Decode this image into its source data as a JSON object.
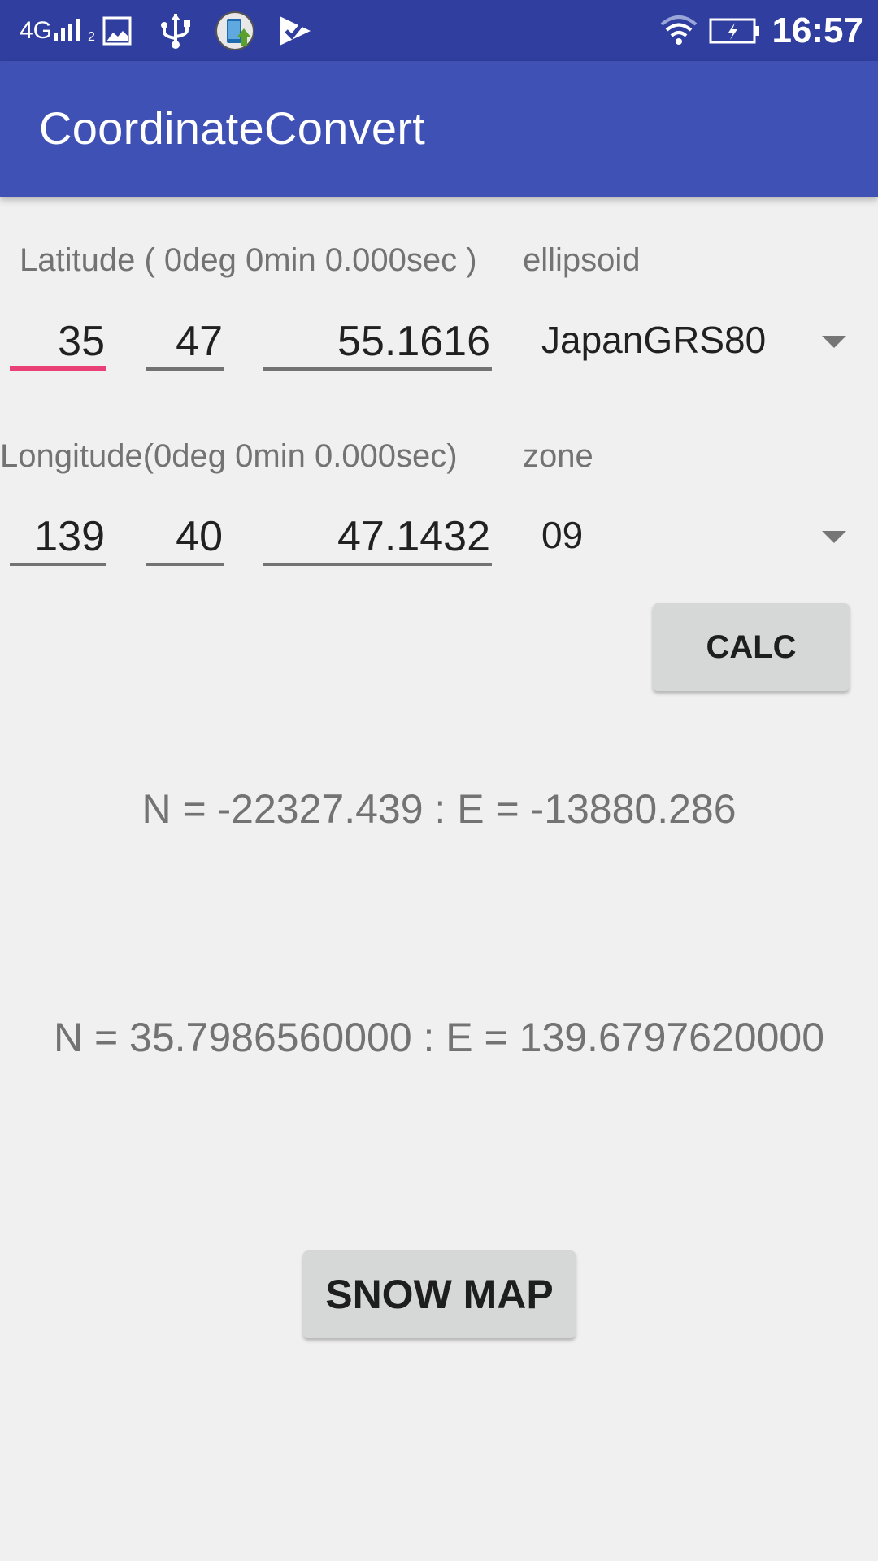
{
  "status_bar": {
    "network": "4G",
    "sim_slot": "2",
    "time": "16:57",
    "icons": [
      "signal-icon",
      "image-icon",
      "usb-icon",
      "app-update-icon",
      "play-store-check-icon",
      "wifi-icon",
      "battery-charging-icon"
    ]
  },
  "app_bar": {
    "title": "CoordinateConvert"
  },
  "latitude": {
    "label": "Latitude ( 0deg 0min 0.000sec )",
    "deg": "35",
    "min": "47",
    "sec": "55.1616"
  },
  "ellipsoid": {
    "label": "ellipsoid",
    "selected": "JapanGRS80"
  },
  "longitude": {
    "label": "Longitude(0deg 0min 0.000sec)",
    "deg": "139",
    "min": "40",
    "sec": "47.1432"
  },
  "zone": {
    "label": "zone",
    "selected": "09"
  },
  "buttons": {
    "calc": "CALC",
    "show_map": "SNOW MAP"
  },
  "results": {
    "plane": "N = -22327.439 : E = -13880.286",
    "geodetic": "N = 35.7986560000 : E = 139.6797620000"
  },
  "colors": {
    "status_bar": "#303f9f",
    "app_bar": "#3f51b5",
    "accent": "#e94077",
    "background": "#f0f0f0"
  }
}
